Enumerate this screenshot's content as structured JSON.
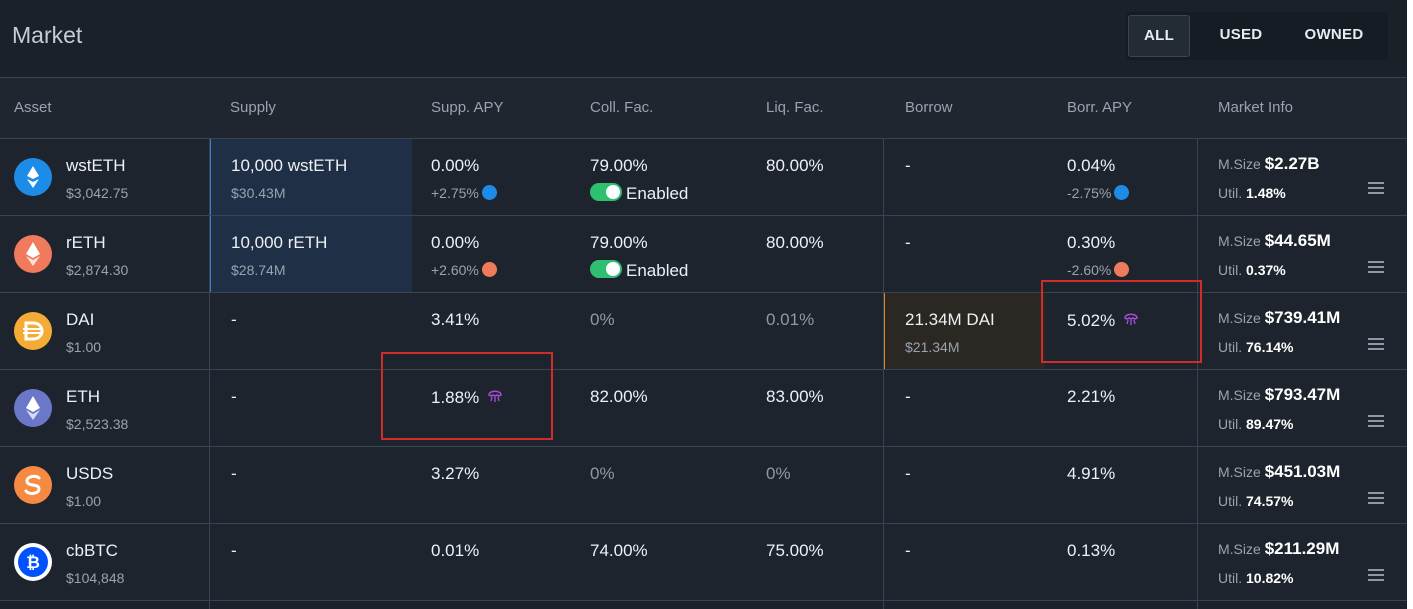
{
  "header": {
    "title": "Market",
    "filters": [
      "ALL",
      "USED",
      "OWNED"
    ],
    "active_filter": "ALL"
  },
  "columns": [
    "Asset",
    "Supply",
    "Supp. APY",
    "Coll. Fac.",
    "Liq. Fac.",
    "Borrow",
    "Borr. APY",
    "Market Info"
  ],
  "labels": {
    "msize": "M.Size",
    "util": "Util.",
    "enabled": "Enabled"
  },
  "rows": [
    {
      "asset": "wstETH",
      "price": "$3,042.75",
      "icon": "wsteth-icon",
      "color": "#1c8ce8",
      "supply": "10,000 wstETH",
      "supply_usd": "$30.43M",
      "supp_apy": "0.00%",
      "supp_apy_extra": "+2.75%",
      "coll_fac": "79.00%",
      "liq_fac": "80.00%",
      "borrow": "-",
      "borrow_usd": "",
      "borr_apy": "0.04%",
      "borr_apy_extra": "-2.75%",
      "msize": "$2.27B",
      "util": "1.48%"
    },
    {
      "asset": "rETH",
      "price": "$2,874.30",
      "icon": "reth-icon",
      "color": "#f07a5c",
      "supply": "10,000 rETH",
      "supply_usd": "$28.74M",
      "supp_apy": "0.00%",
      "supp_apy_extra": "+2.60%",
      "coll_fac": "79.00%",
      "liq_fac": "80.00%",
      "borrow": "-",
      "borrow_usd": "",
      "borr_apy": "0.30%",
      "borr_apy_extra": "-2.60%",
      "msize": "$44.65M",
      "util": "0.37%"
    },
    {
      "asset": "DAI",
      "price": "$1.00",
      "icon": "dai-icon",
      "color": "#f5ac37",
      "supply": "-",
      "supply_usd": "",
      "supp_apy": "3.41%",
      "supp_apy_extra": "",
      "coll_fac": "0%",
      "liq_fac": "0.01%",
      "borrow": "21.34M DAI",
      "borrow_usd": "$21.34M",
      "borr_apy": "5.02%",
      "borr_apy_extra": "",
      "msize": "$739.41M",
      "util": "76.14%"
    },
    {
      "asset": "ETH",
      "price": "$2,523.38",
      "icon": "eth-icon",
      "color": "#6b78c9",
      "supply": "-",
      "supply_usd": "",
      "supp_apy": "1.88%",
      "supp_apy_extra": "",
      "coll_fac": "82.00%",
      "liq_fac": "83.00%",
      "borrow": "-",
      "borrow_usd": "",
      "borr_apy": "2.21%",
      "borr_apy_extra": "",
      "msize": "$793.47M",
      "util": "89.47%"
    },
    {
      "asset": "USDS",
      "price": "$1.00",
      "icon": "usds-icon",
      "color": "#f68a43",
      "supply": "-",
      "supply_usd": "",
      "supp_apy": "3.27%",
      "supp_apy_extra": "",
      "coll_fac": "0%",
      "liq_fac": "0%",
      "borrow": "-",
      "borrow_usd": "",
      "borr_apy": "4.91%",
      "borr_apy_extra": "",
      "msize": "$451.03M",
      "util": "74.57%"
    },
    {
      "asset": "cbBTC",
      "price": "$104,848",
      "icon": "cbbtc-icon",
      "color": "#0052ff",
      "supply": "-",
      "supply_usd": "",
      "supp_apy": "0.01%",
      "supp_apy_extra": "",
      "coll_fac": "74.00%",
      "liq_fac": "75.00%",
      "borrow": "-",
      "borrow_usd": "",
      "borr_apy": "0.13%",
      "borr_apy_extra": "",
      "msize": "$211.29M",
      "util": "10.82%"
    }
  ]
}
